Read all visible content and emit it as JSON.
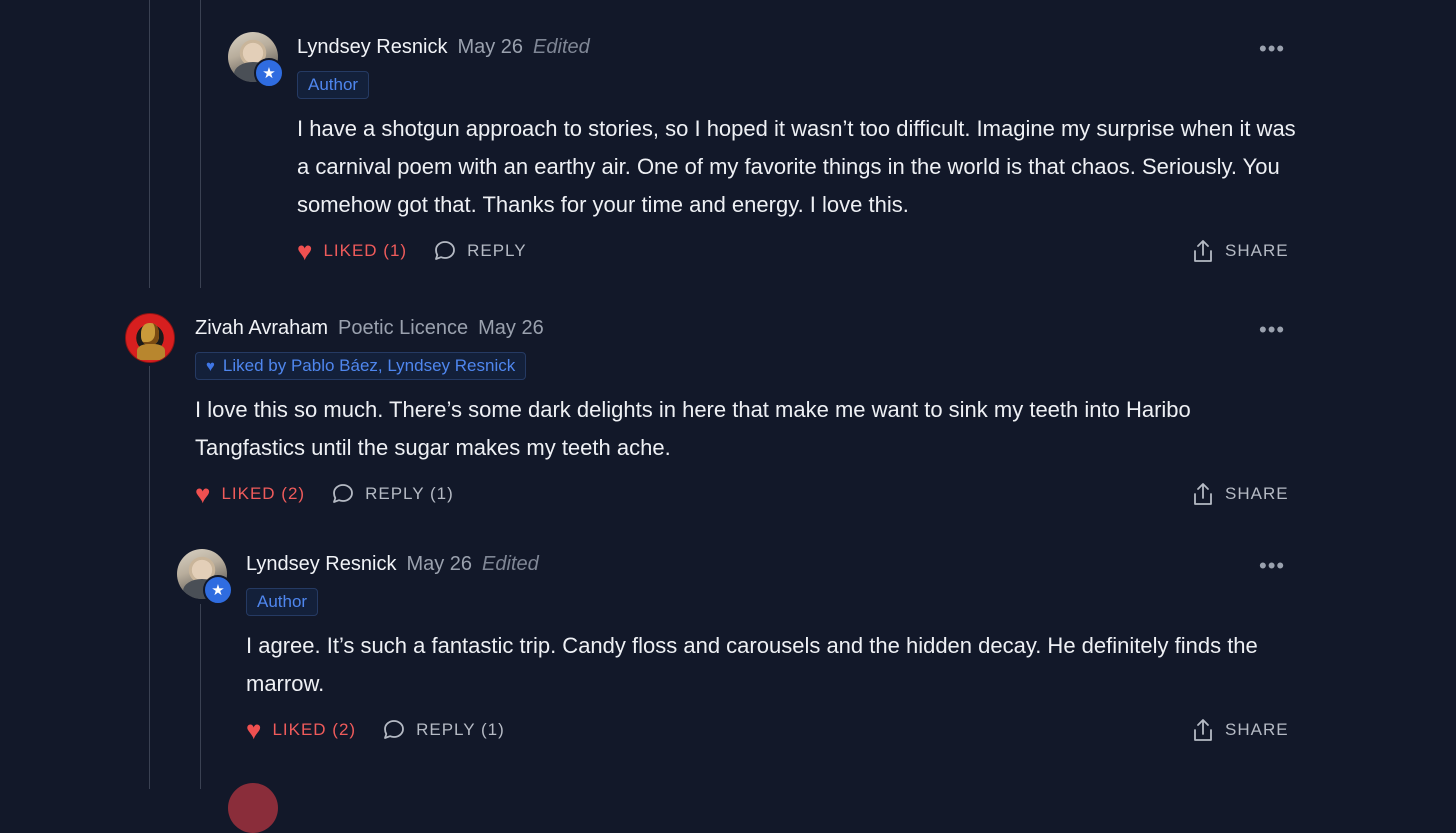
{
  "comments": [
    {
      "author": "Lyndsey Resnick",
      "subtitle": "",
      "date": "May 26",
      "edited_label": "Edited",
      "tag": "Author",
      "text": "I have a shotgun approach to stories, so I hoped it wasn’t too difficult. Imagine my surprise when it was a carnival poem with an earthy air. One of my favorite things in the world is that chaos. Seriously. You somehow got that. Thanks for your time and energy. I love this.",
      "like_label": "LIKED (1)",
      "reply_label": "REPLY",
      "share_label": "SHARE",
      "more_label": "•••"
    },
    {
      "author": "Zivah Avraham",
      "subtitle": "Poetic Licence",
      "date": "May 26",
      "liked_by": "Liked by Pablo Báez, Lyndsey Resnick",
      "text": "I love this so much. There’s some dark delights in here that make me want to sink my teeth into Haribo Tangfastics until the sugar makes my teeth ache.",
      "like_label": "LIKED (2)",
      "reply_label": "REPLY (1)",
      "share_label": "SHARE",
      "more_label": "•••"
    },
    {
      "author": "Lyndsey Resnick",
      "date": "May 26",
      "edited_label": "Edited",
      "tag": "Author",
      "text": "I agree. It’s such a fantastic trip. Candy floss and carousels and the hidden decay. He definitely finds the marrow.",
      "like_label": "LIKED (2)",
      "reply_label": "REPLY (1)",
      "share_label": "SHARE",
      "more_label": "•••"
    }
  ],
  "icons": {
    "heart": "♥",
    "star": "★",
    "reply": "speech-bubble-icon",
    "share": "share-upload-icon"
  },
  "colors": {
    "background": "#121829",
    "liked": "#ef5b5b",
    "accent": "#2f6ce0"
  }
}
